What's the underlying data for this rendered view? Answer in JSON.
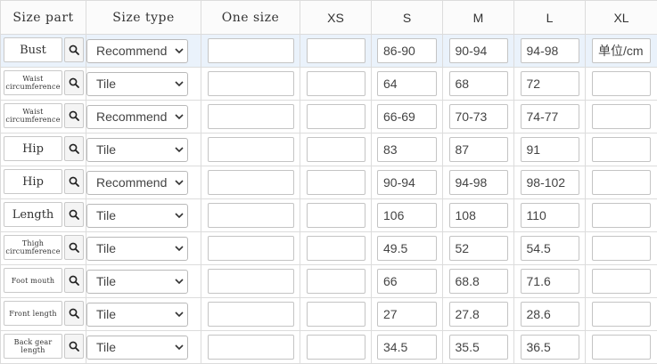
{
  "headers": [
    "Size part",
    "Size type",
    "One size",
    "XS",
    "S",
    "M",
    "L",
    "XL"
  ],
  "colors": {
    "highlight_row": "#eaf2fb",
    "border": "#dcdcdc"
  },
  "icons": {
    "search": "search-icon",
    "dropdown": "chevron-down-icon"
  },
  "rows": [
    {
      "part": "Bust",
      "part_style": "big",
      "type": "Recommend",
      "one_size": "",
      "xs": "",
      "s": "86-90",
      "m": "90-94",
      "l": "94-98",
      "xl": "单位/cm"
    },
    {
      "part": "Waist circumference",
      "part_style": "small",
      "type": "Tile",
      "one_size": "",
      "xs": "",
      "s": "64",
      "m": "68",
      "l": "72",
      "xl": ""
    },
    {
      "part": "Waist circumference",
      "part_style": "small",
      "type": "Recommend",
      "one_size": "",
      "xs": "",
      "s": "66-69",
      "m": "70-73",
      "l": "74-77",
      "xl": ""
    },
    {
      "part": "Hip",
      "part_style": "big",
      "type": "Tile",
      "one_size": "",
      "xs": "",
      "s": "83",
      "m": "87",
      "l": "91",
      "xl": ""
    },
    {
      "part": "Hip",
      "part_style": "big",
      "type": "Recommend",
      "one_size": "",
      "xs": "",
      "s": "90-94",
      "m": "94-98",
      "l": "98-102",
      "xl": ""
    },
    {
      "part": "Length",
      "part_style": "big",
      "type": "Tile",
      "one_size": "",
      "xs": "",
      "s": "106",
      "m": "108",
      "l": "110",
      "xl": ""
    },
    {
      "part": "Thigh circumference",
      "part_style": "small",
      "type": "Tile",
      "one_size": "",
      "xs": "",
      "s": "49.5",
      "m": "52",
      "l": "54.5",
      "xl": ""
    },
    {
      "part": "Foot mouth",
      "part_style": "small",
      "type": "Tile",
      "one_size": "",
      "xs": "",
      "s": "66",
      "m": "68.8",
      "l": "71.6",
      "xl": ""
    },
    {
      "part": "Front length",
      "part_style": "small",
      "type": "Tile",
      "one_size": "",
      "xs": "",
      "s": "27",
      "m": "27.8",
      "l": "28.6",
      "xl": ""
    },
    {
      "part": "Back gear length",
      "part_style": "small",
      "type": "Tile",
      "one_size": "",
      "xs": "",
      "s": "34.5",
      "m": "35.5",
      "l": "36.5",
      "xl": ""
    }
  ]
}
